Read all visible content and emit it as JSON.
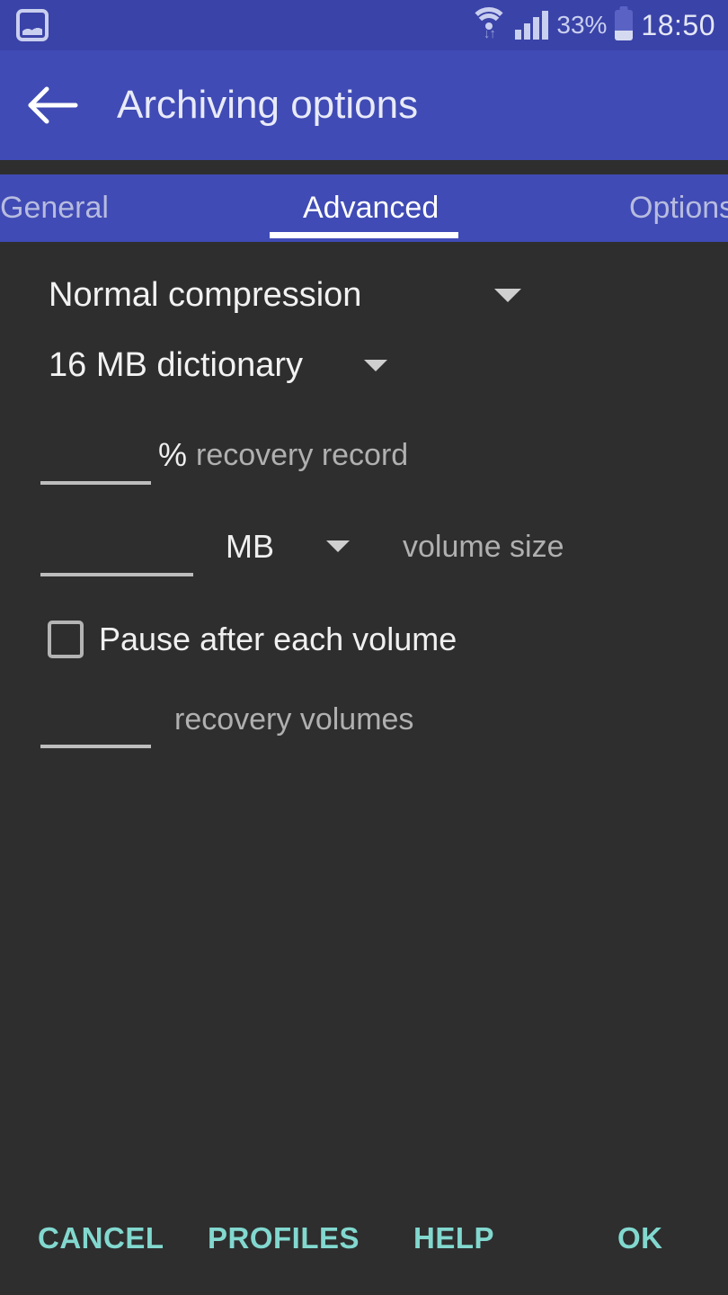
{
  "status_bar": {
    "notification_icon": "image-icon",
    "wifi_icon": "wifi-icon",
    "wifi_transfer_glyph": "↓↑",
    "signal_icon": "signal-bars-icon",
    "battery_percent": "33%",
    "battery_icon": "battery-icon",
    "time": "18:50"
  },
  "app_bar": {
    "back_icon": "back-arrow-icon",
    "title": "Archiving options"
  },
  "tabs": [
    {
      "label": "General",
      "active": false
    },
    {
      "label": "Advanced",
      "active": true
    },
    {
      "label": "Options",
      "active": false
    }
  ],
  "form": {
    "compression": {
      "value": "Normal compression",
      "caret_icon": "chevron-down-icon"
    },
    "dictionary": {
      "value": "16 MB dictionary",
      "caret_icon": "chevron-down-icon"
    },
    "recovery_record": {
      "value": "",
      "placeholder": "",
      "unit": "%",
      "label": "recovery record"
    },
    "volume_size": {
      "value": "",
      "placeholder": "",
      "unit": "MB",
      "caret_icon": "chevron-down-icon",
      "label": "volume size"
    },
    "pause_after_volume": {
      "label": "Pause after each volume",
      "checked": false
    },
    "recovery_volumes": {
      "value": "",
      "placeholder": "",
      "label": "recovery volumes"
    }
  },
  "bottom_bar": {
    "cancel": "CANCEL",
    "profiles": "PROFILES",
    "help": "HELP",
    "ok": "OK"
  },
  "colors": {
    "status_bar_bg": "#3a43a8",
    "app_bar_bg": "#404bb5",
    "tab_bar_bg": "#404bb5",
    "content_bg": "#2e2e2e",
    "accent_button": "#82d8cf",
    "tab_indicator": "#ffffff",
    "icon_tint": "#c9cfee"
  }
}
